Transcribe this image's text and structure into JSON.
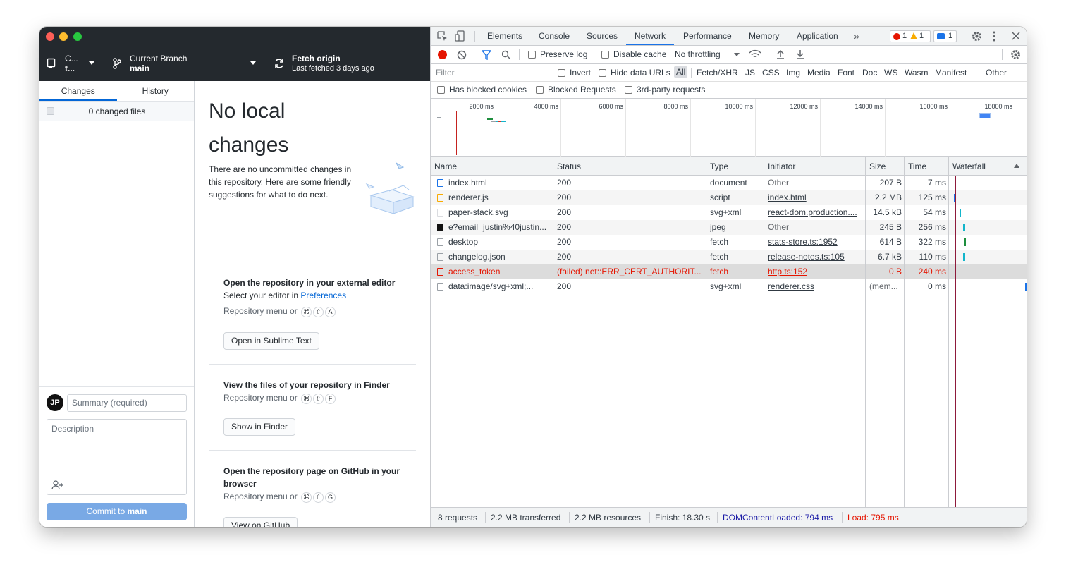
{
  "github": {
    "repo_label_top": "C...",
    "repo_label_bottom": "t...",
    "branch_label": "Current Branch",
    "branch_value": "main",
    "fetch_label": "Fetch origin",
    "fetch_sub": "Last fetched 3 days ago",
    "tabs": [
      "Changes",
      "History"
    ],
    "changed_files": "0 changed files",
    "heading_line1": "No local",
    "heading_line2": "changes",
    "note": "There are no uncommitted changes in this repository. Here are some friendly suggestions for what to do next.",
    "editor_title": "Open the repository in your external editor",
    "editor_sub_prefix": "Select your editor in ",
    "editor_sub_link": "Preferences",
    "repo_menu_or": "Repository menu or",
    "key_cmd": "⌘",
    "key_shift": "⇧",
    "key_a": "A",
    "key_f": "F",
    "key_g": "G",
    "open_btn": "Open in Sublime Text",
    "finder_title": "View the files of your repository in Finder",
    "finder_btn": "Show in Finder",
    "gh_title": "Open the repository page on GitHub in your browser",
    "gh_btn": "View on GitHub",
    "avatar_initials": "JP",
    "summary_placeholder": "Summary (required)",
    "description_placeholder": "Description",
    "commit_prefix": "Commit to ",
    "commit_branch": "main"
  },
  "devtools": {
    "tabs": [
      "Elements",
      "Console",
      "Sources",
      "Network",
      "Performance",
      "Memory",
      "Application"
    ],
    "more": "»",
    "badges": {
      "errors": "1",
      "warnings": "1",
      "messages": "1"
    },
    "preserve_log": "Preserve log",
    "disable_cache": "Disable cache",
    "throttling": "No throttling",
    "filter_placeholder": "Filter",
    "invert": "Invert",
    "hide_data_urls": "Hide data URLs",
    "type_filters": [
      "All",
      "Fetch/XHR",
      "JS",
      "CSS",
      "Img",
      "Media",
      "Font",
      "Doc",
      "WS",
      "Wasm",
      "Manifest",
      "Other"
    ],
    "has_blocked_cookies": "Has blocked cookies",
    "blocked_requests": "Blocked Requests",
    "third_party": "3rd-party requests",
    "overview_ticks": [
      "2000 ms",
      "4000 ms",
      "6000 ms",
      "8000 ms",
      "10000 ms",
      "12000 ms",
      "14000 ms",
      "16000 ms",
      "18000 ms"
    ],
    "columns": [
      "Name",
      "Status",
      "Type",
      "Initiator",
      "Size",
      "Time",
      "Waterfall"
    ],
    "rows": [
      {
        "name": "index.html",
        "status": "200",
        "type": "document",
        "initiator": "Other",
        "size": "207 B",
        "time": "7 ms"
      },
      {
        "name": "renderer.js",
        "status": "200",
        "type": "script",
        "initiator": "index.html",
        "size": "2.2 MB",
        "time": "125 ms"
      },
      {
        "name": "paper-stack.svg",
        "status": "200",
        "type": "svg+xml",
        "initiator": "react-dom.production....",
        "size": "14.5 kB",
        "time": "54 ms"
      },
      {
        "name": "e?email=justin%40justin...",
        "status": "200",
        "type": "jpeg",
        "initiator": "Other",
        "size": "245 B",
        "time": "256 ms"
      },
      {
        "name": "desktop",
        "status": "200",
        "type": "fetch",
        "initiator": "stats-store.ts:1952",
        "size": "614 B",
        "time": "322 ms"
      },
      {
        "name": "changelog.json",
        "status": "200",
        "type": "fetch",
        "initiator": "release-notes.ts:105",
        "size": "6.7 kB",
        "time": "110 ms"
      },
      {
        "name": "access_token",
        "status": "(failed) net::ERR_CERT_AUTHORIT...",
        "type": "fetch",
        "initiator": "http.ts:152",
        "size": "0 B",
        "time": "240 ms"
      },
      {
        "name": "data:image/svg+xml;...",
        "status": "200",
        "type": "svg+xml",
        "initiator": "renderer.css",
        "size": "(mem...",
        "time": "0 ms"
      }
    ],
    "footer": {
      "requests": "8 requests",
      "transferred": "2.2 MB transferred",
      "resources": "2.2 MB resources",
      "finish": "Finish: 18.30 s",
      "dcl": "DOMContentLoaded: 794 ms",
      "load": "Load: 795 ms"
    },
    "colors": {
      "accent": "#1a73e8",
      "error": "#e51400",
      "dcl": "#1a1aa6"
    }
  }
}
